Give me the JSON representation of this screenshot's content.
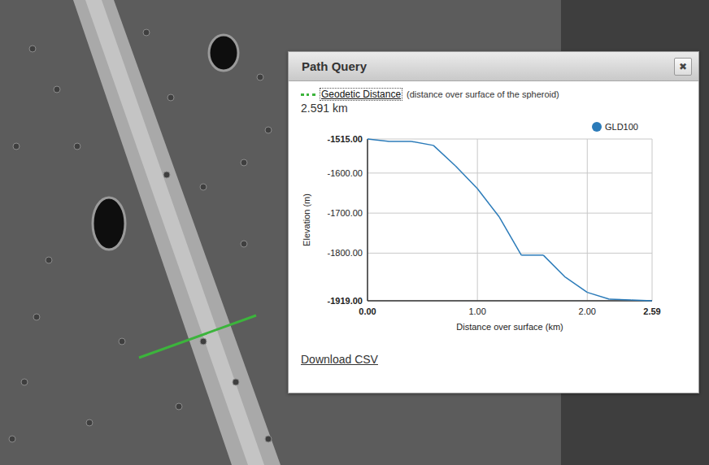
{
  "panel": {
    "title": "Path Query",
    "close": "✖",
    "measure": {
      "label": "Geodetic Distance",
      "note": "(distance over surface of the spheroid)",
      "value": "2.591 km"
    },
    "chart": {
      "y_axis": {
        "title": "Elevation (m)",
        "ticks": [
          "-1515.00",
          "-1600.00",
          "-1700.00",
          "-1800.00",
          "-1919.00"
        ]
      },
      "x_axis": {
        "title": "Distance over surface (km)",
        "ticks": [
          "0.00",
          "1.00",
          "2.00",
          "2.59"
        ]
      },
      "series": [
        {
          "name": "GLD100",
          "distance_km": [
            0,
            0.2,
            0.4,
            0.6,
            0.8,
            1.0,
            1.2,
            1.4,
            1.6,
            1.8,
            2.0,
            2.2,
            2.4,
            2.59
          ],
          "elevation_m": [
            -1515,
            -1521,
            -1521,
            -1531,
            -1582,
            -1639,
            -1710,
            -1805,
            -1805,
            -1860,
            -1898,
            -1915,
            -1917,
            -1919
          ]
        }
      ]
    },
    "link": "Download CSV"
  }
}
